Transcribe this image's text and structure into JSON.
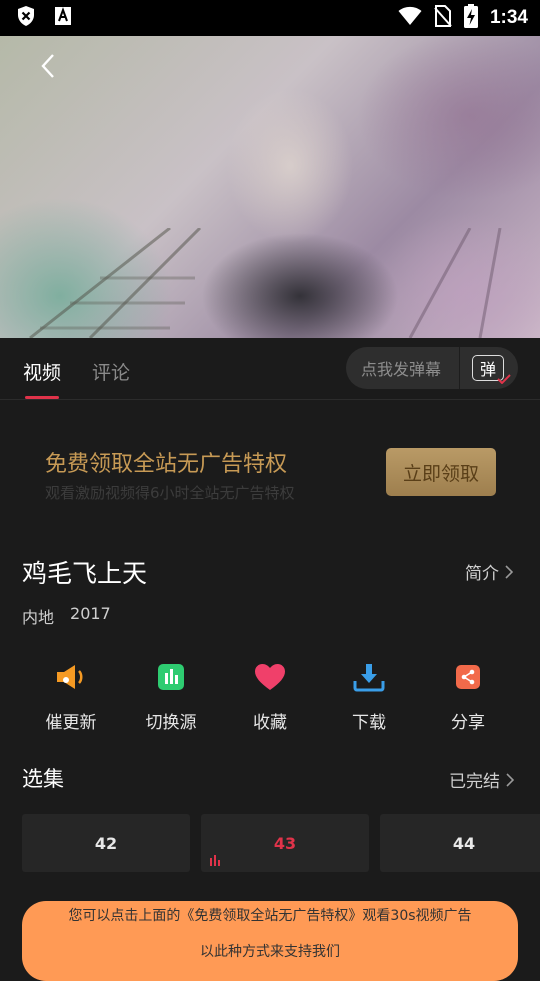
{
  "status_bar": {
    "time": "1:34",
    "icons": [
      "shield-x-icon",
      "font-a-icon",
      "wifi-icon",
      "no-sim-icon",
      "battery-charging-icon"
    ]
  },
  "player": {
    "back_icon": "chevron-left-icon"
  },
  "tabs": [
    {
      "label": "视频",
      "active": true
    },
    {
      "label": "评论",
      "active": false
    }
  ],
  "danmu": {
    "placeholder": "点我发弹幕",
    "toggle_label": "弹"
  },
  "promo": {
    "title": "免费领取全站无广告特权",
    "subtitle": "观看激励视频得6小时全站无广告特权",
    "button": "立即领取"
  },
  "show": {
    "title": "鸡毛飞上天",
    "intro_link": "简介",
    "region": "内地",
    "year": "2017"
  },
  "actions": [
    {
      "label": "催更新",
      "icon": "megaphone-icon",
      "color": "#f59a23"
    },
    {
      "label": "切换源",
      "icon": "source-switch-icon",
      "color": "#2ecc71"
    },
    {
      "label": "收藏",
      "icon": "heart-icon",
      "color": "#f0406a"
    },
    {
      "label": "下载",
      "icon": "download-icon",
      "color": "#3a9ee8"
    },
    {
      "label": "分享",
      "icon": "share-icon",
      "color": "#f26a4a"
    }
  ],
  "episodes": {
    "title": "选集",
    "status": "已完结",
    "items": [
      {
        "label": "42",
        "active": false
      },
      {
        "label": "43",
        "active": true
      },
      {
        "label": "44",
        "active": false
      }
    ]
  },
  "notice": {
    "line1": "您可以点击上面的《免费领取全站无广告特权》观看30s视频广告",
    "line2": "以此种方式来支持我们"
  },
  "colors": {
    "accent": "#e0334a",
    "gold": "#c79a55",
    "notice_bg": "#ff9a55"
  }
}
